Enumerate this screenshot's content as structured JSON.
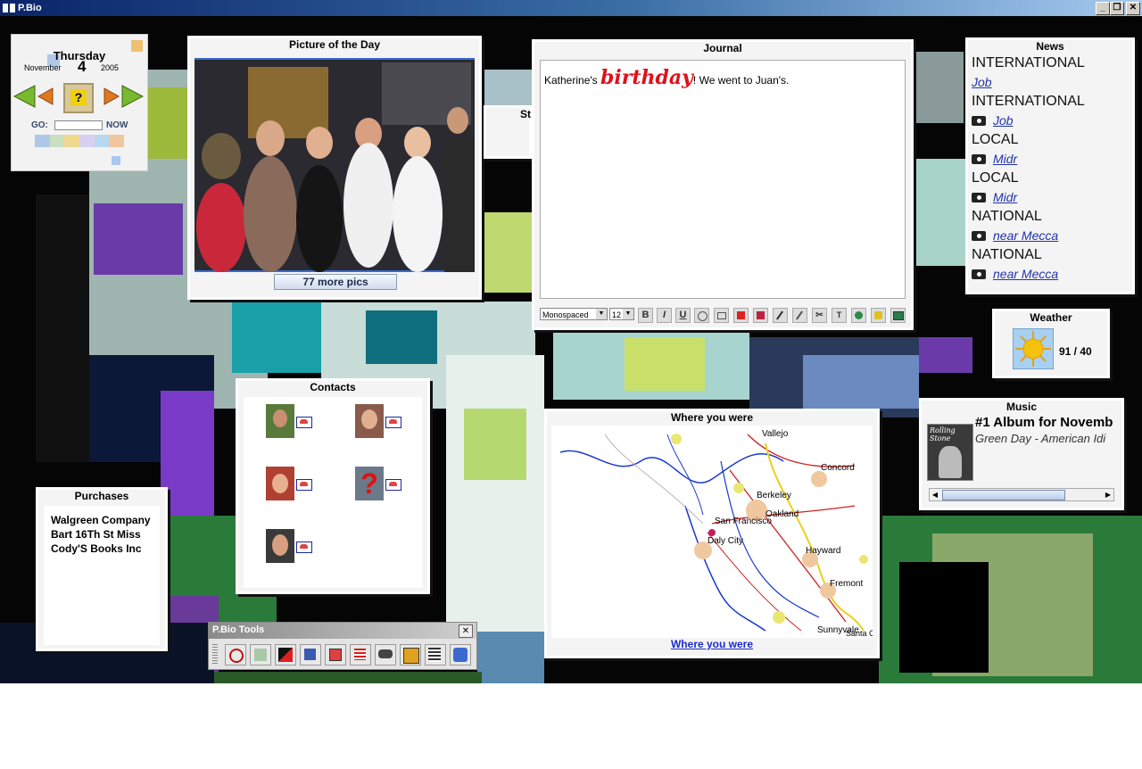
{
  "app": {
    "title": "P.Bio",
    "minimize": "_",
    "restore": "❐",
    "close": "✕"
  },
  "calendar": {
    "weekday": "Thursday",
    "month": "November",
    "day": "4",
    "year": "2005",
    "help": "?",
    "go_label": "GO:",
    "go_value": "",
    "now_label": "NOW"
  },
  "picture": {
    "title": "Picture of the Day",
    "more_button": "77 more pics"
  },
  "stub": {
    "label": "St"
  },
  "journal": {
    "title": "Journal",
    "text_before": "Katherine's ",
    "text_highlight": "birthday",
    "text_after": "! We went to Juan's.",
    "font": "Monospaced",
    "size": "12",
    "bold": "B",
    "italic": "I",
    "underline": "U"
  },
  "news": {
    "title": "News",
    "items": [
      {
        "category": "INTERNATIONAL",
        "link": "Job",
        "camera": false
      },
      {
        "category": "INTERNATIONAL",
        "link": "Job",
        "camera": true
      },
      {
        "category": "LOCAL",
        "link": "Midr",
        "camera": true
      },
      {
        "category": "LOCAL",
        "link": "Midr",
        "camera": true
      },
      {
        "category": "NATIONAL",
        "link": "near Mecca",
        "camera": true
      },
      {
        "category": "NATIONAL",
        "link": "near Mecca",
        "camera": true
      }
    ]
  },
  "weather": {
    "title": "Weather",
    "temps": "91 / 40",
    "icon": "sun-icon",
    "sun_color": "#f4c20d"
  },
  "contacts": {
    "title": "Contacts"
  },
  "where": {
    "title": "Where you were",
    "link": "Where you were",
    "cities": [
      "Vallejo",
      "Concord",
      "Berkeley",
      "Oakland",
      "San Francisco",
      "Daly City",
      "Hayward",
      "Fremont",
      "Sunnyvale",
      "Santa Cl"
    ]
  },
  "music": {
    "title": "Music",
    "headline": "#1 Album for Novemb",
    "album": "Green Day - American Idi",
    "cover_text": "Rolling Stone"
  },
  "purchases": {
    "title": "Purchases",
    "items": [
      "Walgreen Company",
      "Bart 16Th St Miss",
      "Cody'S Books Inc"
    ]
  },
  "tools": {
    "title": "P.Bio Tools",
    "close": "✕"
  },
  "colors": {
    "accent_blue": "#0a246a",
    "link_blue": "#2233aa",
    "birthday_red": "#e0101a"
  }
}
